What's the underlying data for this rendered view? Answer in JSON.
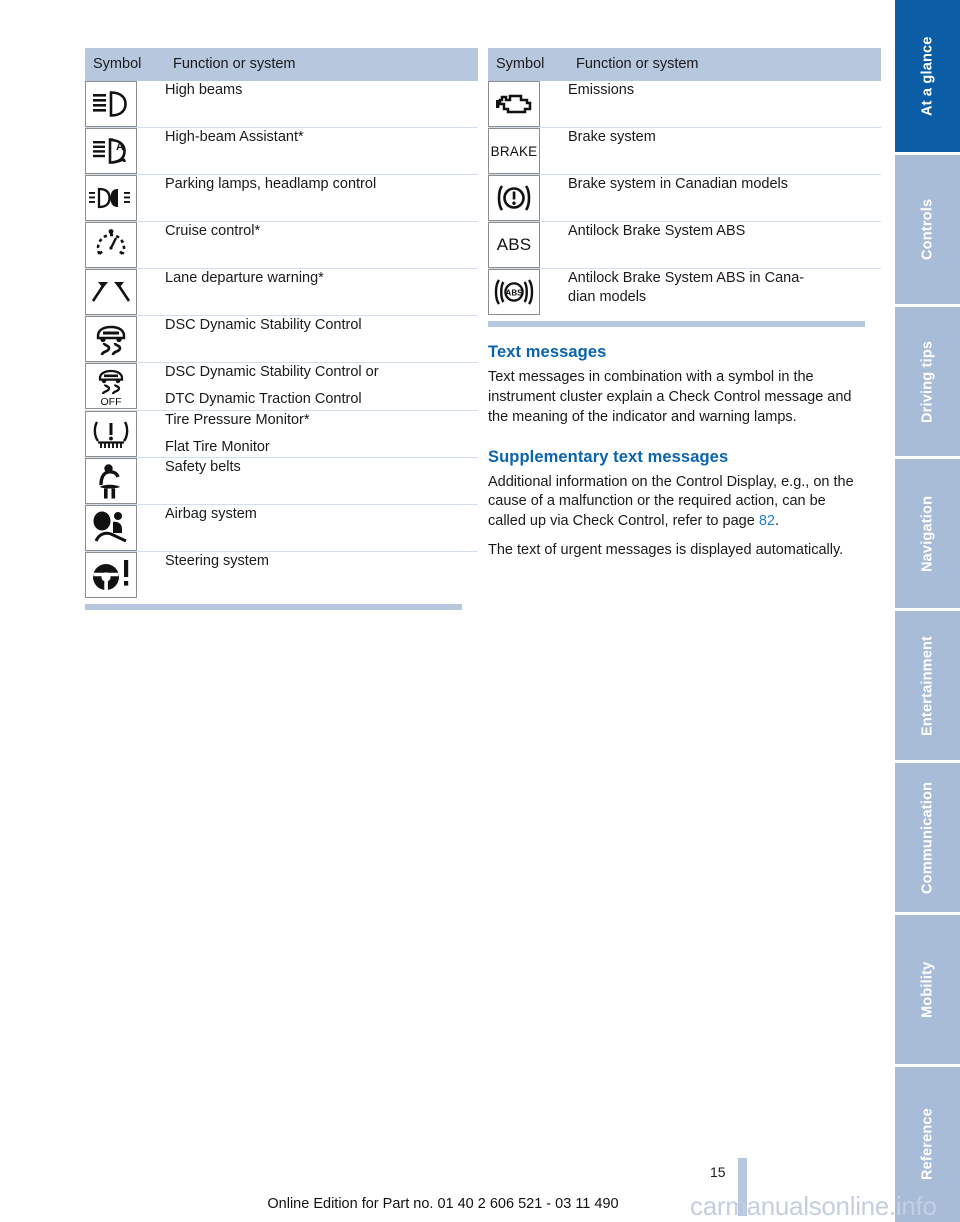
{
  "document": {
    "page_number": "15",
    "footer_edition": "Online Edition for Part no. 01 40 2 606 521 - 03 11 490",
    "watermark": "carmanualsonline.info"
  },
  "tables": {
    "left": {
      "header": {
        "symbol": "Symbol",
        "function": "Function or system"
      },
      "rows": [
        {
          "icon": "high-beams-icon",
          "label": "High beams"
        },
        {
          "icon": "high-beam-assistant-icon",
          "label": "High-beam Assistant*"
        },
        {
          "icon": "parking-lamps-icon",
          "label": "Parking lamps, headlamp control"
        },
        {
          "icon": "cruise-control-icon",
          "label": "Cruise control*"
        },
        {
          "icon": "lane-departure-warning-icon",
          "label": "Lane departure warning*"
        },
        {
          "icon": "dsc-icon",
          "label": "DSC Dynamic Stability Control"
        },
        {
          "icon": "dsc-off-icon",
          "label": "DSC Dynamic Stability Control or",
          "label2": "DTC Dynamic Traction Control"
        },
        {
          "icon": "tire-pressure-monitor-icon",
          "label": "Tire Pressure Monitor*",
          "label2": "Flat Tire Monitor"
        },
        {
          "icon": "safety-belts-icon",
          "label": "Safety belts"
        },
        {
          "icon": "airbag-system-icon",
          "label": "Airbag system"
        },
        {
          "icon": "steering-system-icon",
          "label": "Steering system"
        }
      ]
    },
    "right": {
      "header": {
        "symbol": "Symbol",
        "function": "Function or system"
      },
      "rows": [
        {
          "icon": "emissions-engine-icon",
          "label": "Emissions"
        },
        {
          "icon": "brake-text-icon",
          "label": "Brake system",
          "icon_text": "BRAKE"
        },
        {
          "icon": "brake-canadian-icon",
          "label": "Brake system in Canadian models"
        },
        {
          "icon": "abs-text-icon",
          "label": "Antilock Brake System ABS",
          "icon_text": "ABS"
        },
        {
          "icon": "abs-canadian-icon",
          "label": "Antilock Brake System ABS in Cana-",
          "label2": "dian models"
        }
      ]
    }
  },
  "prose": {
    "section1": {
      "heading": "Text messages",
      "paragraphs": [
        "Text messages in combination with a symbol in the instrument cluster explain a Check Control message and the meaning of the indicator and warning lamps."
      ]
    },
    "section2": {
      "heading": "Supplementary text messages",
      "para1_before": "Additional information on the Control Display, e.g., on the cause of a malfunction or the required action, can be called up via Check Control, refer to page ",
      "para1_ref": "82",
      "para1_after": ".",
      "para2": "The text of urgent messages is displayed automatically."
    }
  },
  "tabs": [
    {
      "label": "At a glance",
      "active": true
    },
    {
      "label": "Controls",
      "active": false
    },
    {
      "label": "Driving tips",
      "active": false
    },
    {
      "label": "Navigation",
      "active": false
    },
    {
      "label": "Entertainment",
      "active": false
    },
    {
      "label": "Communication",
      "active": false
    },
    {
      "label": "Mobility",
      "active": false
    },
    {
      "label": "Reference",
      "active": false
    }
  ],
  "colors": {
    "tab_active": "#0b5da6",
    "tab_inactive": "#a8bcd8",
    "table_header_bg": "#b7c7de",
    "heading_blue": "#0a63ae",
    "link_blue": "#1f7fd0"
  }
}
